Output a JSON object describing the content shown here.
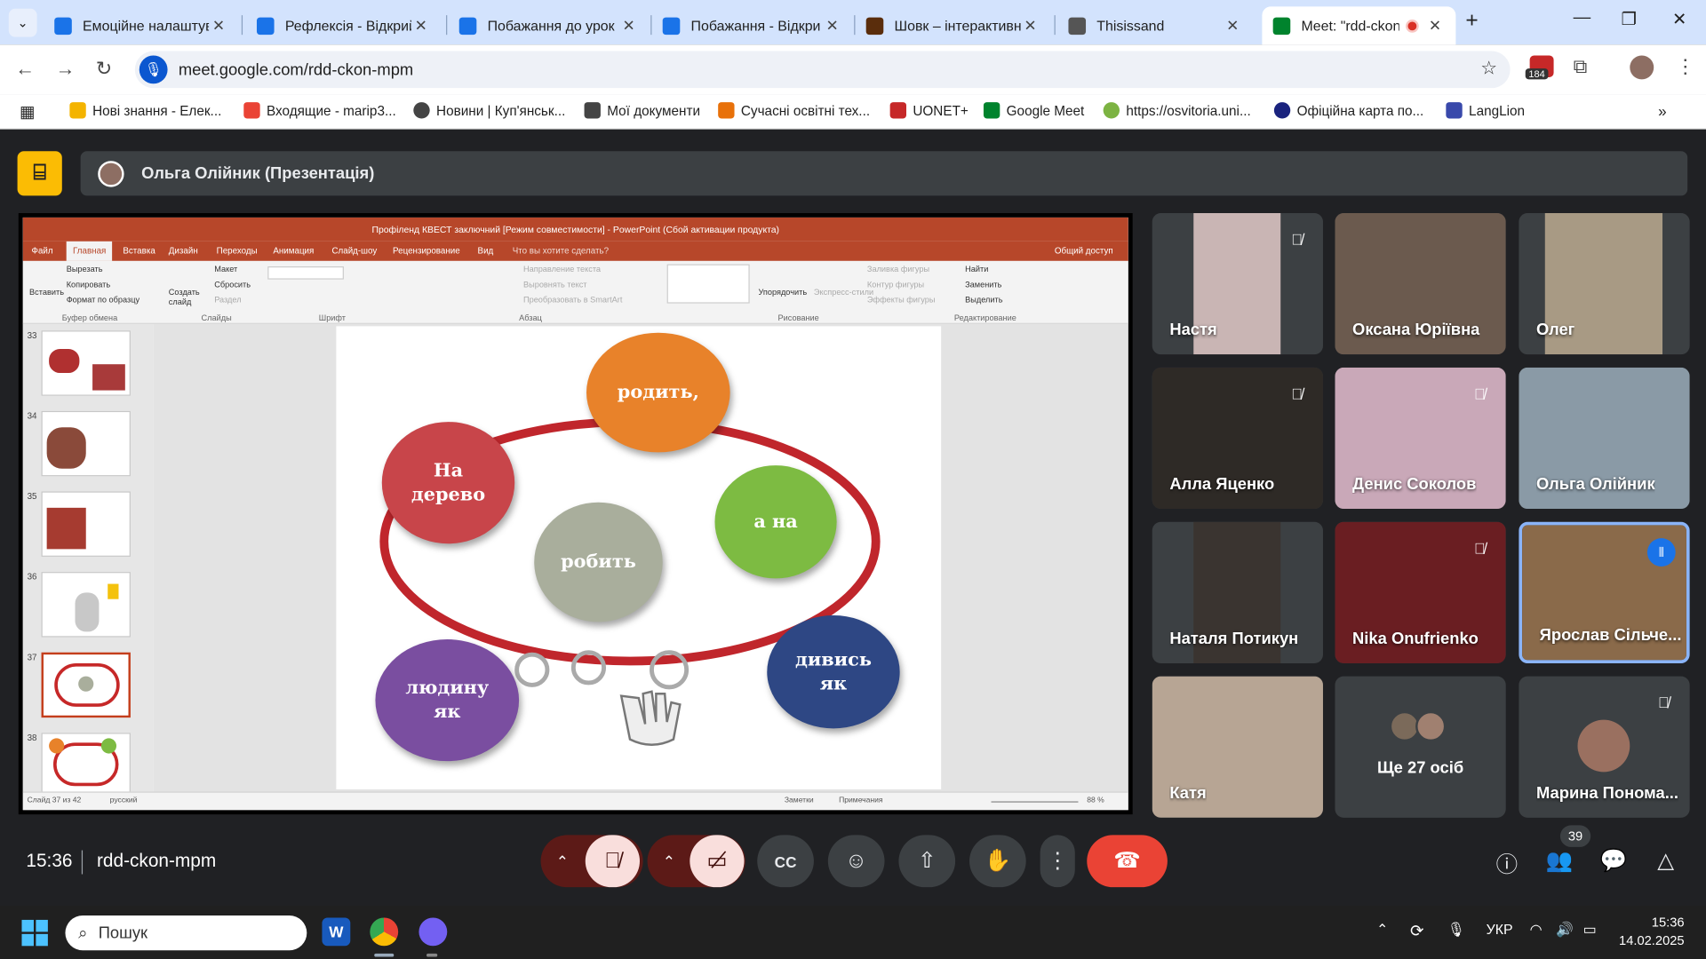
{
  "browser": {
    "tabs": [
      {
        "title": "Емоційне налаштува",
        "favicon_color": "#1a73e8"
      },
      {
        "title": "Рефлексія - Відкрий",
        "favicon_color": "#1a73e8"
      },
      {
        "title": "Побажання до урок",
        "favicon_color": "#1a73e8"
      },
      {
        "title": "Побажання - Відкри",
        "favicon_color": "#1a73e8"
      },
      {
        "title": "Шовк – інтерактивн",
        "favicon_color": "#5a2d0c"
      },
      {
        "title": "Thisissand",
        "favicon_color": "#555555"
      },
      {
        "title": "Meet: \"rdd-ckon-",
        "favicon_color": "#00832d"
      }
    ],
    "new_tab_symbol": "+",
    "url": "meet.google.com/rdd-ckon-mpm",
    "downloads_badge": "184",
    "bookmarks": [
      {
        "label": "Нові знання - Елек...",
        "icon_color": "#f4b400"
      },
      {
        "label": "Входящие - marip3...",
        "icon_color": "#ea4335"
      },
      {
        "label": "Новини | Куп'янськ...",
        "icon_color": "#444444"
      },
      {
        "label": "Мої документи",
        "icon_color": "#444444"
      },
      {
        "label": "Сучасні освітні тех...",
        "icon_color": "#e8710a"
      },
      {
        "label": "UONET+",
        "icon_color": "#c62828"
      },
      {
        "label": "Google Meet",
        "icon_color": "#00832d"
      },
      {
        "label": "https://osvitoria.uni...",
        "icon_color": "#7cb342"
      },
      {
        "label": "Офіційна карта по...",
        "icon_color": "#1a237e"
      },
      {
        "label": "LangLion",
        "icon_color": "#3949ab"
      }
    ]
  },
  "meet": {
    "presenter_label": "Ольга Олійник (Презентація)",
    "time": "15:36",
    "meeting_code": "rdd-ckon-mpm",
    "participants_count": "39",
    "more_people_label": "Ще 27 осіб",
    "participants": [
      {
        "name": "Настя",
        "muted": true,
        "bg": "#b9a7a7"
      },
      {
        "name": "Оксана Юріївна",
        "muted": false,
        "bg": "#6b5a4e"
      },
      {
        "name": "Олег",
        "muted": false,
        "bg": "#a89a84"
      },
      {
        "name": "Алла Яценко",
        "muted": true,
        "bg": "#2e2a26"
      },
      {
        "name": "Денис Соколов",
        "muted": true,
        "bg": "#c9a8b8"
      },
      {
        "name": "Ольга Олійник",
        "muted": false,
        "bg": "#8a9aa6"
      },
      {
        "name": "Наталя Потикун",
        "muted": false,
        "bg": "#3a3430"
      },
      {
        "name": "Nika Onufrienko",
        "muted": true,
        "bg": "#6a1e22"
      },
      {
        "name": "Ярослав Сільче...",
        "muted": false,
        "bg": "#8a6a4a"
      },
      {
        "name": "Катя",
        "muted": false,
        "bg": "#b7a594"
      },
      {
        "name": "Марина Понома...",
        "muted": true,
        "bg": "#3c4043"
      }
    ]
  },
  "ppt": {
    "title": "Профіленд КВЕСТ заключний [Режим совместимости] - PowerPoint (Сбой активации продукта)",
    "tabs": [
      "Файл",
      "Главная",
      "Вставка",
      "Дизайн",
      "Переходы",
      "Анимация",
      "Слайд-шоу",
      "Рецензирование",
      "Вид",
      "Что вы хотите сделать?"
    ],
    "share": "Общий доступ",
    "ribbon": {
      "paste": "Вставить",
      "cut": "Вырезать",
      "copy": "Копировать",
      "format_painter": "Формат по образцу",
      "new_slide": "Создать слайд",
      "layout": "Макет",
      "reset": "Сбросить",
      "section": "Раздел",
      "text_direction": "Направление текста",
      "align_text": "Выровнять текст",
      "smartart": "Преобразовать в SmartArt",
      "arrange": "Упорядочить",
      "quick_styles": "Экспресс-стили",
      "shape_fill": "Заливка фигуры",
      "shape_outline": "Контур фигуры",
      "shape_effects": "Эффекты фигуры",
      "find": "Найти",
      "replace": "Заменить",
      "select": "Выделить",
      "groups": [
        "Буфер обмена",
        "Слайды",
        "Шрифт",
        "Абзац",
        "Рисование",
        "Редактирование"
      ]
    },
    "slide_numbers": [
      "33",
      "34",
      "35",
      "36",
      "37",
      "38"
    ],
    "bubbles": [
      {
        "text": "родить,",
        "color": "#e8822a"
      },
      {
        "text": "На\nдерево",
        "color": "#c8454a"
      },
      {
        "text": "а на",
        "color": "#7dbb42"
      },
      {
        "text": "робить",
        "color": "#a9ae9c"
      },
      {
        "text": "дивись\nяк",
        "color": "#2e4784"
      },
      {
        "text": "людину\nяк",
        "color": "#7a4ea0"
      }
    ],
    "status_left": "Слайд 37 из 42",
    "status_lang": "русский",
    "notes": "Заметки",
    "comments": "Примечания",
    "zoom": "88 %"
  },
  "taskbar": {
    "search_placeholder": "Пошук",
    "lang": "УКР",
    "time": "15:36",
    "date": "14.02.2025"
  }
}
